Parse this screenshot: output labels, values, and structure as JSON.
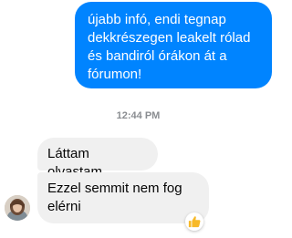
{
  "conversation": {
    "outgoing_message": "újabb infó, endi tegnap\ndekkrészegen leakelt rólad\nés bandiról órákon át a\nfórumon!",
    "timestamp": "12:44 PM",
    "incoming_messages": [
      {
        "text": "Láttam olvastam"
      },
      {
        "text": "Ezzel semmit nem fog\nelérni"
      }
    ],
    "reaction_icon": "thumbs-up-icon",
    "colors": {
      "outgoing_bubble": "#0084ff",
      "incoming_bubble": "#f0f0f0",
      "reaction_yellow": "#f7b928"
    }
  }
}
